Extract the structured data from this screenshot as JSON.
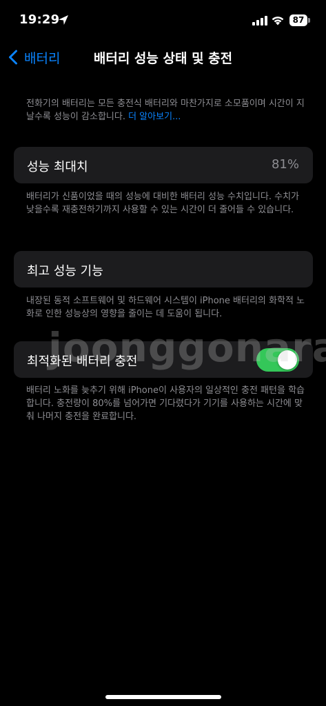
{
  "status_bar": {
    "time": "19:29",
    "battery": "87"
  },
  "nav": {
    "back_label": "배터리",
    "title": "배터리 성능 상태 및 충전"
  },
  "intro": {
    "text": "전화기의 배터리는 모든 충전식 배터리와 마찬가지로 소모품이며 시간이 지날수록 성능이 감소합니다. ",
    "link": "더 알아보기..."
  },
  "max_capacity": {
    "label": "성능 최대치",
    "value": "81%",
    "footer": "배터리가 신품이었을 때의 성능에 대비한 배터리 성능 수치입니다. 수치가 낮을수록 재충전하기까지 사용할 수 있는 시간이 더 줄어들 수 있습니다."
  },
  "peak_performance": {
    "label": "최고 성능 기능",
    "footer": "내장된 동적 소프트웨어 및 하드웨어 시스템이 iPhone 배터리의 화학적 노화로 인한 성능상의 영향을 줄이는 데 도움이 됩니다."
  },
  "optimized_charging": {
    "label": "최적화된 배터리 충전",
    "enabled": true,
    "footer": "배터리 노화를 늦추기 위해 iPhone이 사용자의 일상적인 충전 패턴을 학습합니다. 충전량이 80%를 넘어가면 기다렸다가 기기를 사용하는 시간에 맞춰 나머지 충전을 완료합니다."
  },
  "watermark": "joonggonara",
  "colors": {
    "accent": "#0a84ff",
    "toggle_on": "#34c759",
    "cell_bg": "#1c1c1e",
    "secondary_text": "#8e8e93"
  }
}
